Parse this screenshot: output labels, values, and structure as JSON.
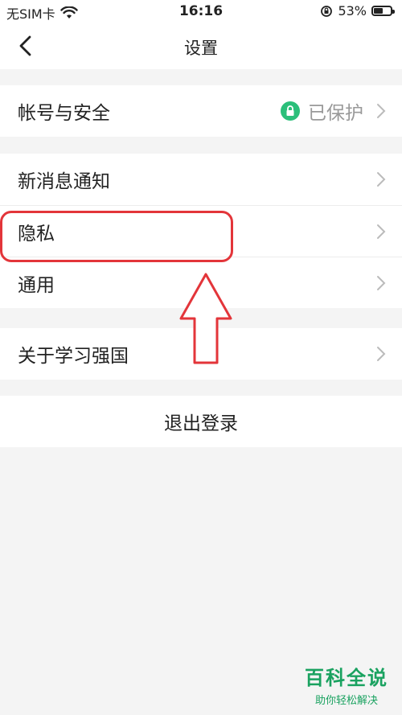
{
  "status_bar": {
    "carrier": "无SIM卡",
    "time": "16:16",
    "battery_percent": "53%",
    "battery_level": 0.53
  },
  "nav": {
    "title": "设置"
  },
  "settings": {
    "account": {
      "label": "帐号与安全",
      "value": "已保护"
    },
    "notifications": {
      "label": "新消息通知"
    },
    "privacy": {
      "label": "隐私"
    },
    "general": {
      "label": "通用"
    },
    "about": {
      "label": "关于学习强国"
    },
    "logout": {
      "label": "退出登录"
    }
  },
  "annotation": {
    "highlight_color": "#e3353a"
  },
  "colors": {
    "accent_green": "#1aa260",
    "lock_badge": "#2bbf7a"
  },
  "watermark": {
    "title": "百科全说",
    "subtitle": "助你轻松解决"
  }
}
